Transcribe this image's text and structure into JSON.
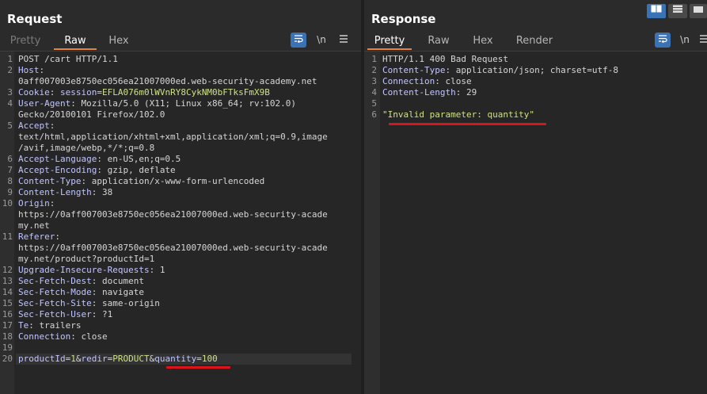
{
  "request": {
    "title": "Request",
    "tabs": [
      "Pretty",
      "Raw",
      "Hex"
    ],
    "active_tab": "Raw",
    "tools": {
      "wrap_icon": "wrap-lines-icon",
      "newline": "\\n",
      "menu_icon": "hamburger-menu-icon"
    },
    "lines": [
      {
        "n": "1",
        "parts": [
          {
            "t": "POST /cart HTTP/1.1",
            "c": "hv"
          }
        ]
      },
      {
        "n": "2",
        "parts": [
          {
            "t": "Host",
            "c": "hn"
          },
          {
            "t": ":",
            "c": "hv"
          }
        ]
      },
      {
        "n": "",
        "parts": [
          {
            "t": "0aff007003e8750ec056ea21007000ed.web-security-academy.net",
            "c": "hv"
          }
        ]
      },
      {
        "n": "3",
        "parts": [
          {
            "t": "Cookie",
            "c": "hn"
          },
          {
            "t": ": ",
            "c": "hv"
          },
          {
            "t": "session",
            "c": "hn"
          },
          {
            "t": "=",
            "c": "hv"
          },
          {
            "t": "EFLA076m0lWVnRY8CykNM0bFTksFmX9B",
            "c": "str"
          }
        ]
      },
      {
        "n": "4",
        "parts": [
          {
            "t": "User-Agent",
            "c": "hn"
          },
          {
            "t": ": Mozilla/5.0 (X11; Linux x86_64; rv:102.0)",
            "c": "hv"
          }
        ]
      },
      {
        "n": "",
        "parts": [
          {
            "t": "Gecko/20100101 Firefox/102.0",
            "c": "hv"
          }
        ]
      },
      {
        "n": "5",
        "parts": [
          {
            "t": "Accept",
            "c": "hn"
          },
          {
            "t": ":",
            "c": "hv"
          }
        ]
      },
      {
        "n": "",
        "parts": [
          {
            "t": "text/html,application/xhtml+xml,application/xml;q=0.9,image",
            "c": "hv"
          }
        ]
      },
      {
        "n": "",
        "parts": [
          {
            "t": "/avif,image/webp,*/*;q=0.8",
            "c": "hv"
          }
        ]
      },
      {
        "n": "6",
        "parts": [
          {
            "t": "Accept-Language",
            "c": "hn"
          },
          {
            "t": ": en-US,en;q=0.5",
            "c": "hv"
          }
        ]
      },
      {
        "n": "7",
        "parts": [
          {
            "t": "Accept-Encoding",
            "c": "hn"
          },
          {
            "t": ": gzip, deflate",
            "c": "hv"
          }
        ]
      },
      {
        "n": "8",
        "parts": [
          {
            "t": "Content-Type",
            "c": "hn"
          },
          {
            "t": ": application/x-www-form-urlencoded",
            "c": "hv"
          }
        ]
      },
      {
        "n": "9",
        "parts": [
          {
            "t": "Content-Length",
            "c": "hn"
          },
          {
            "t": ": 38",
            "c": "hv"
          }
        ]
      },
      {
        "n": "10",
        "parts": [
          {
            "t": "Origin",
            "c": "hn"
          },
          {
            "t": ":",
            "c": "hv"
          }
        ]
      },
      {
        "n": "",
        "parts": [
          {
            "t": "https://0aff007003e8750ec056ea21007000ed.web-security-acade",
            "c": "hv"
          }
        ]
      },
      {
        "n": "",
        "parts": [
          {
            "t": "my.net",
            "c": "hv"
          }
        ]
      },
      {
        "n": "11",
        "parts": [
          {
            "t": "Referer",
            "c": "hn"
          },
          {
            "t": ":",
            "c": "hv"
          }
        ]
      },
      {
        "n": "",
        "parts": [
          {
            "t": "https://0aff007003e8750ec056ea21007000ed.web-security-acade",
            "c": "hv"
          }
        ]
      },
      {
        "n": "",
        "parts": [
          {
            "t": "my.net/product?productId=1",
            "c": "hv"
          }
        ]
      },
      {
        "n": "12",
        "parts": [
          {
            "t": "Upgrade-Insecure-Requests",
            "c": "hn"
          },
          {
            "t": ": 1",
            "c": "hv"
          }
        ]
      },
      {
        "n": "13",
        "parts": [
          {
            "t": "Sec-Fetch-Dest",
            "c": "hn"
          },
          {
            "t": ": document",
            "c": "hv"
          }
        ]
      },
      {
        "n": "14",
        "parts": [
          {
            "t": "Sec-Fetch-Mode",
            "c": "hn"
          },
          {
            "t": ": navigate",
            "c": "hv"
          }
        ]
      },
      {
        "n": "15",
        "parts": [
          {
            "t": "Sec-Fetch-Site",
            "c": "hn"
          },
          {
            "t": ": same-origin",
            "c": "hv"
          }
        ]
      },
      {
        "n": "16",
        "parts": [
          {
            "t": "Sec-Fetch-User",
            "c": "hn"
          },
          {
            "t": ": ?1",
            "c": "hv"
          }
        ]
      },
      {
        "n": "17",
        "parts": [
          {
            "t": "Te",
            "c": "hn"
          },
          {
            "t": ": trailers",
            "c": "hv"
          }
        ]
      },
      {
        "n": "18",
        "parts": [
          {
            "t": "Connection",
            "c": "hn"
          },
          {
            "t": ": close",
            "c": "hv"
          }
        ]
      },
      {
        "n": "19",
        "parts": []
      },
      {
        "n": "20",
        "parts": [
          {
            "t": "productId",
            "c": "hn"
          },
          {
            "t": "=",
            "c": "hv"
          },
          {
            "t": "1",
            "c": "str"
          },
          {
            "t": "&",
            "c": "hv"
          },
          {
            "t": "redir",
            "c": "hn"
          },
          {
            "t": "=",
            "c": "hv"
          },
          {
            "t": "PRODUCT",
            "c": "str"
          },
          {
            "t": "&",
            "c": "hv"
          },
          {
            "t": "quantity",
            "c": "hn"
          },
          {
            "t": "=",
            "c": "hv"
          },
          {
            "t": "100",
            "c": "str"
          }
        ]
      }
    ]
  },
  "response": {
    "title": "Response",
    "tabs": [
      "Pretty",
      "Raw",
      "Hex",
      "Render"
    ],
    "active_tab": "Pretty",
    "tools": {
      "wrap_icon": "wrap-lines-icon",
      "newline": "\\n",
      "menu_icon": "hamburger-menu-icon"
    },
    "lines": [
      {
        "n": "1",
        "parts": [
          {
            "t": "HTTP/1.1 400 Bad Request",
            "c": "hv"
          }
        ]
      },
      {
        "n": "2",
        "parts": [
          {
            "t": "Content-Type",
            "c": "hn"
          },
          {
            "t": ": application/json; charset=utf-8",
            "c": "hv"
          }
        ]
      },
      {
        "n": "3",
        "parts": [
          {
            "t": "Connection",
            "c": "hn"
          },
          {
            "t": ": close",
            "c": "hv"
          }
        ]
      },
      {
        "n": "4",
        "parts": [
          {
            "t": "Content-Length",
            "c": "hn"
          },
          {
            "t": ": 29",
            "c": "hv"
          }
        ]
      },
      {
        "n": "5",
        "parts": []
      },
      {
        "n": "6",
        "parts": [
          {
            "t": "\"Invalid parameter: quantity\"",
            "c": "str"
          }
        ]
      }
    ]
  },
  "layout_buttons": [
    "split-horizontal-icon",
    "split-vertical-icon",
    "single-pane-icon"
  ],
  "colors": {
    "accent": "#e8823a",
    "blue": "#3a73b5",
    "underline": "#d9141b"
  }
}
